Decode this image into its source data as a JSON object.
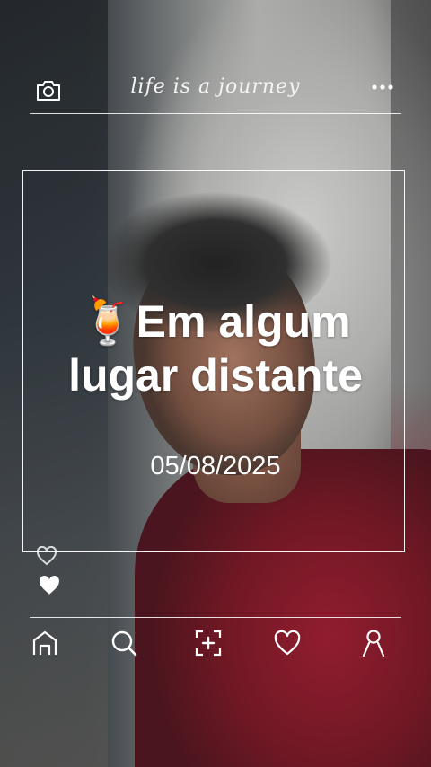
{
  "header": {
    "title": "life is a journey",
    "camera_icon": "camera-icon",
    "more_icon": "more-horizontal-icon"
  },
  "post": {
    "emoji": "🍹",
    "headline_line1": "Em algum",
    "headline_line2": "lugar distante",
    "date": "05/08/2025"
  },
  "side": {
    "icons": [
      "heart-outline-icon",
      "heart-filled-icon"
    ]
  },
  "bottom_nav": {
    "items": [
      "home-icon",
      "search-icon",
      "add-icon",
      "heart-icon",
      "profile-icon"
    ]
  },
  "colors": {
    "line": "#ffffff",
    "shirt": "#7a0c1d"
  }
}
